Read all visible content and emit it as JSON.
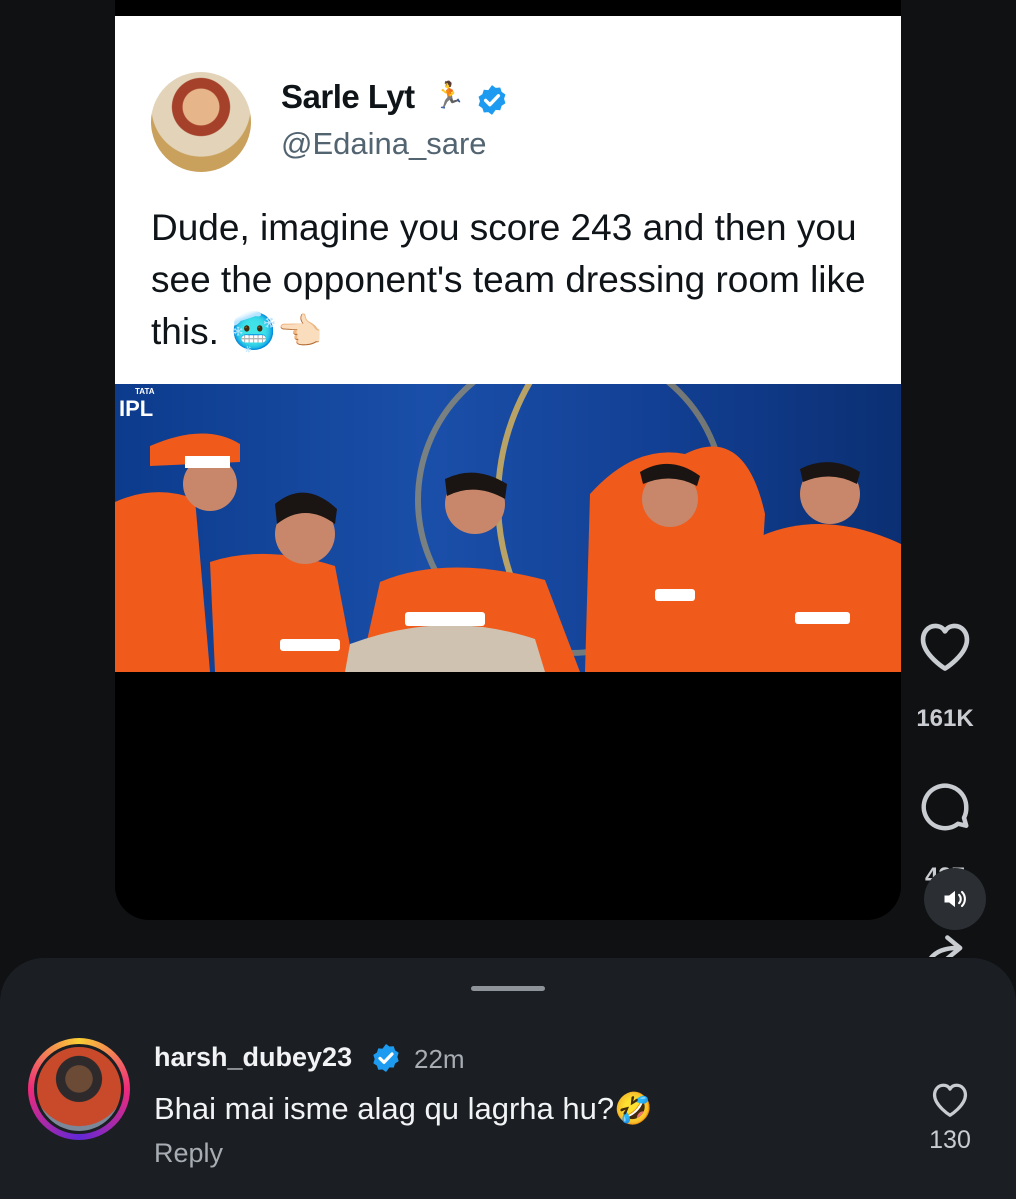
{
  "post": {
    "tweet": {
      "name": "Sarle Lyt",
      "name_emoji": "🏃",
      "handle": "@Edaina_sare",
      "text": "Dude, imagine you score 243 and then you see the opponent's team dressing room like this.",
      "text_emoji": "🥶👈🏻"
    },
    "photo": {
      "logo_small": "TATA",
      "logo": "IPL"
    }
  },
  "side_actions": {
    "likes": "161K",
    "comments": "437"
  },
  "comment": {
    "username": "harsh_dubey23",
    "time": "22m",
    "text": "Bhai mai isme alag qu lagrha hu?🤣",
    "reply_label": "Reply",
    "likes": "130"
  },
  "colors": {
    "verified": "#1d9bf0",
    "sheet_bg": "#1b1f24",
    "jersey": "#f05a1a"
  },
  "icons": [
    "verified-badge-icon",
    "heart-icon",
    "comment-icon",
    "share-icon",
    "sound-icon"
  ]
}
